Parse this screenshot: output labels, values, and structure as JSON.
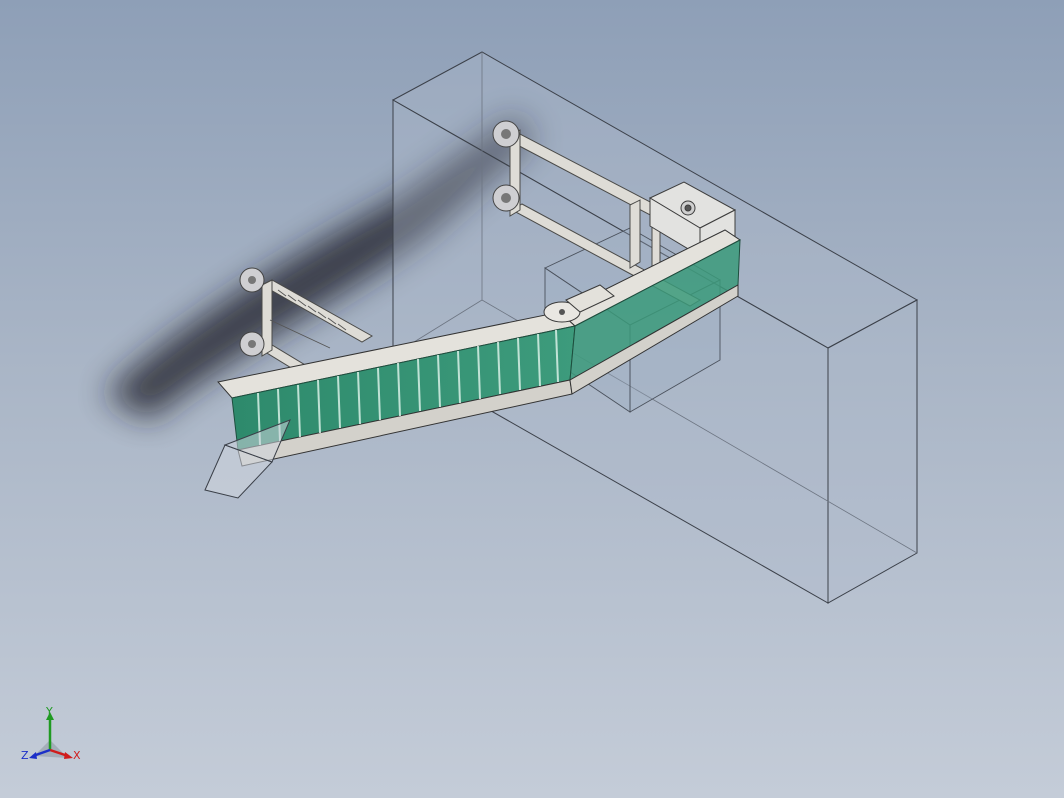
{
  "view": {
    "background_top": "#8e9fb7",
    "background_bottom": "#c4ccd8"
  },
  "model": {
    "belt_color": "#2f8f70",
    "frame_color": "#dcdad4",
    "box_edge_color": "#3a3f48"
  },
  "triad": {
    "y_label": "Y",
    "x_label": "X",
    "z_label": "Z",
    "y_color": "#1f9a22",
    "x_color": "#d01c1c",
    "z_color": "#1b2fc8"
  }
}
